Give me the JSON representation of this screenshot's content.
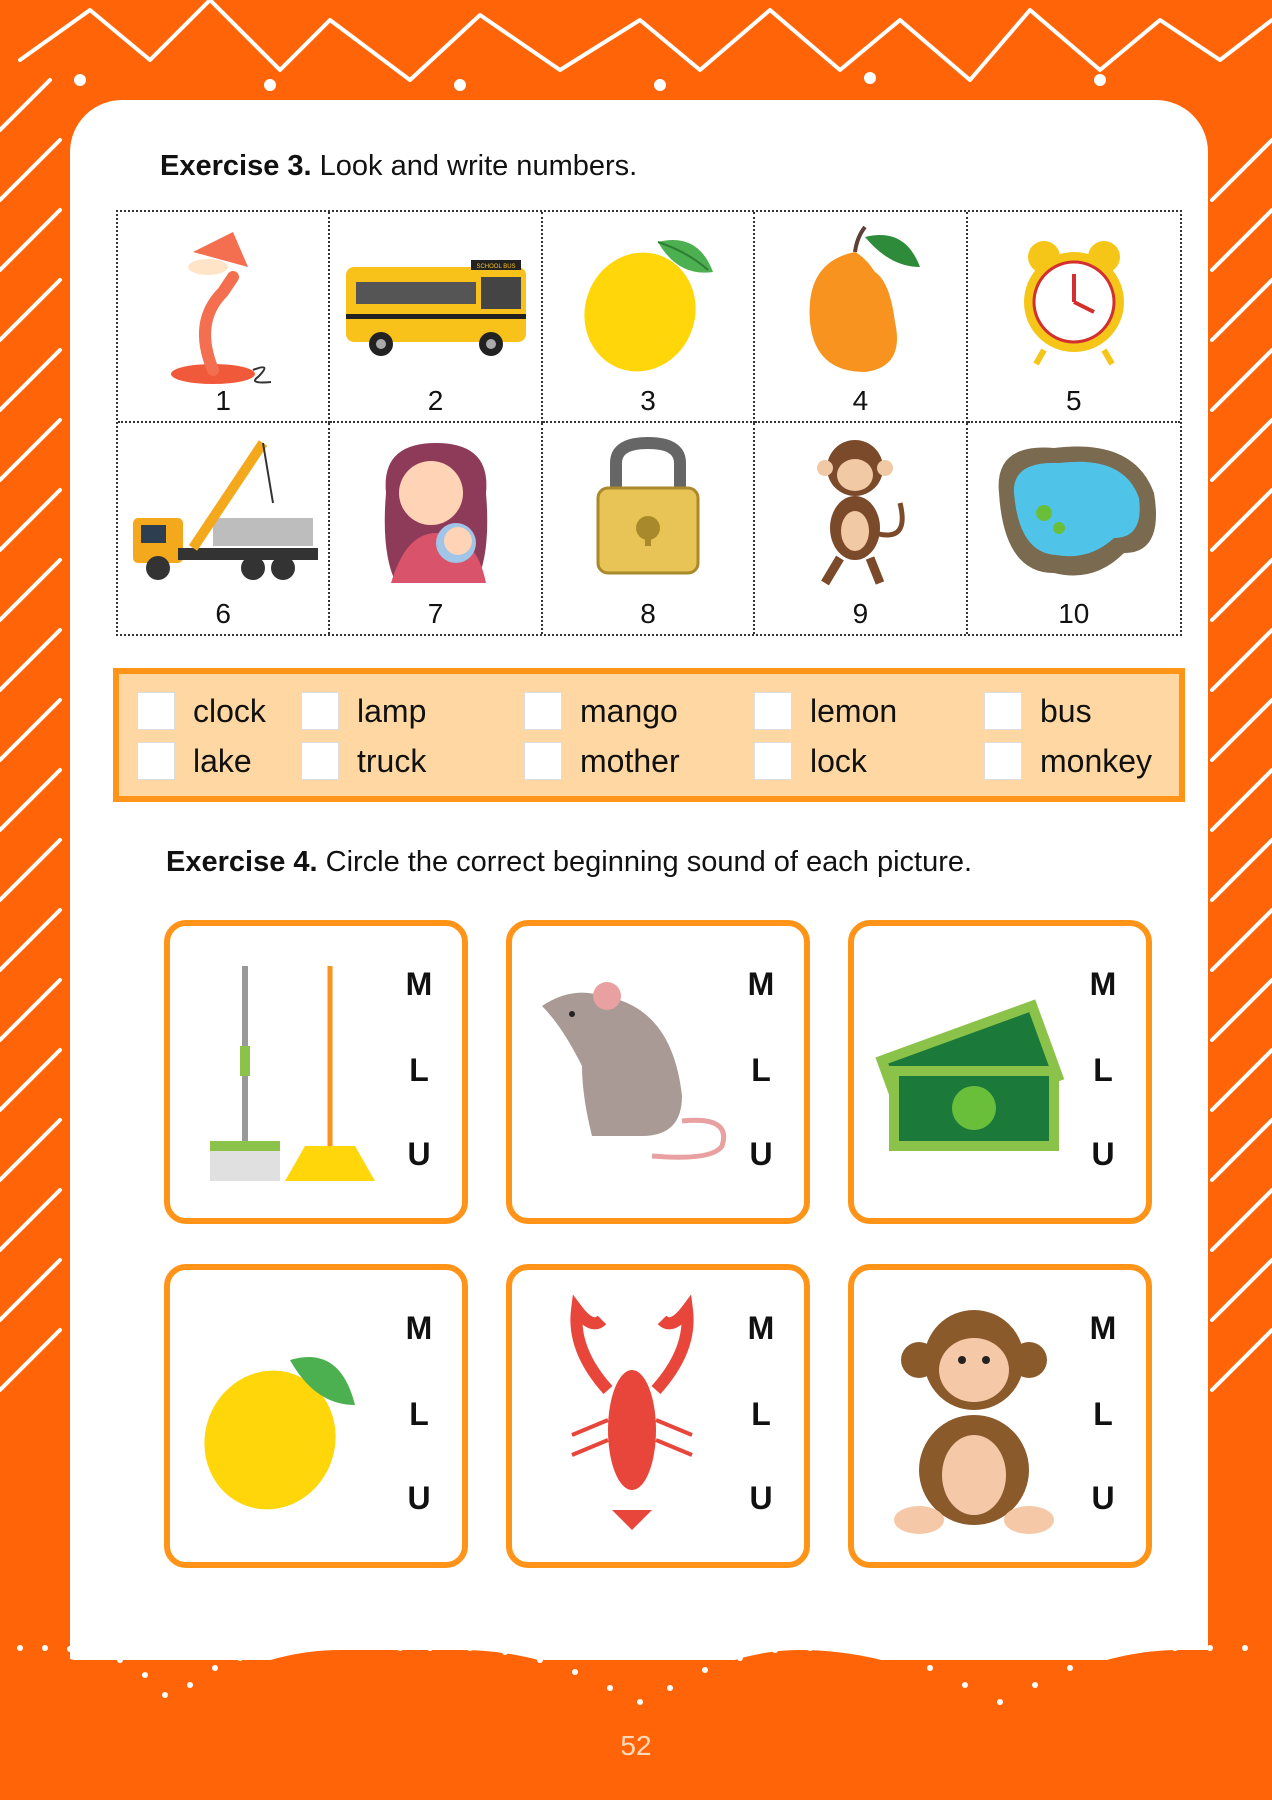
{
  "exercise3": {
    "label": "Exercise 3.",
    "instruction": "Look and write numbers.",
    "pictures": [
      {
        "number": "1",
        "icon": "desk-lamp-icon"
      },
      {
        "number": "2",
        "icon": "school-bus-icon",
        "sign": "SCHOOL BUS"
      },
      {
        "number": "3",
        "icon": "lemon-icon"
      },
      {
        "number": "4",
        "icon": "mango-icon"
      },
      {
        "number": "5",
        "icon": "alarm-clock-icon"
      },
      {
        "number": "6",
        "icon": "crane-truck-icon"
      },
      {
        "number": "7",
        "icon": "mother-baby-icon"
      },
      {
        "number": "8",
        "icon": "padlock-icon"
      },
      {
        "number": "9",
        "icon": "monkey-icon"
      },
      {
        "number": "10",
        "icon": "lake-icon"
      }
    ],
    "words": [
      [
        "clock",
        "lamp",
        "mango",
        "lemon",
        "bus"
      ],
      [
        "lake",
        "truck",
        "mother",
        "lock",
        "monkey"
      ]
    ]
  },
  "exercise4": {
    "label": "Exercise 4.",
    "instruction": "Circle the correct beginning sound of each picture.",
    "options": [
      "M",
      "L",
      "U"
    ],
    "pictures": [
      "mops-brooms-icon",
      "mouse-icon",
      "money-icon",
      "lemon-icon",
      "lobster-icon",
      "monkey-icon"
    ]
  },
  "page_number": "52",
  "colors": {
    "background": "#FF6508",
    "accent": "#FF9419",
    "word_box": "#FFD7A2"
  }
}
